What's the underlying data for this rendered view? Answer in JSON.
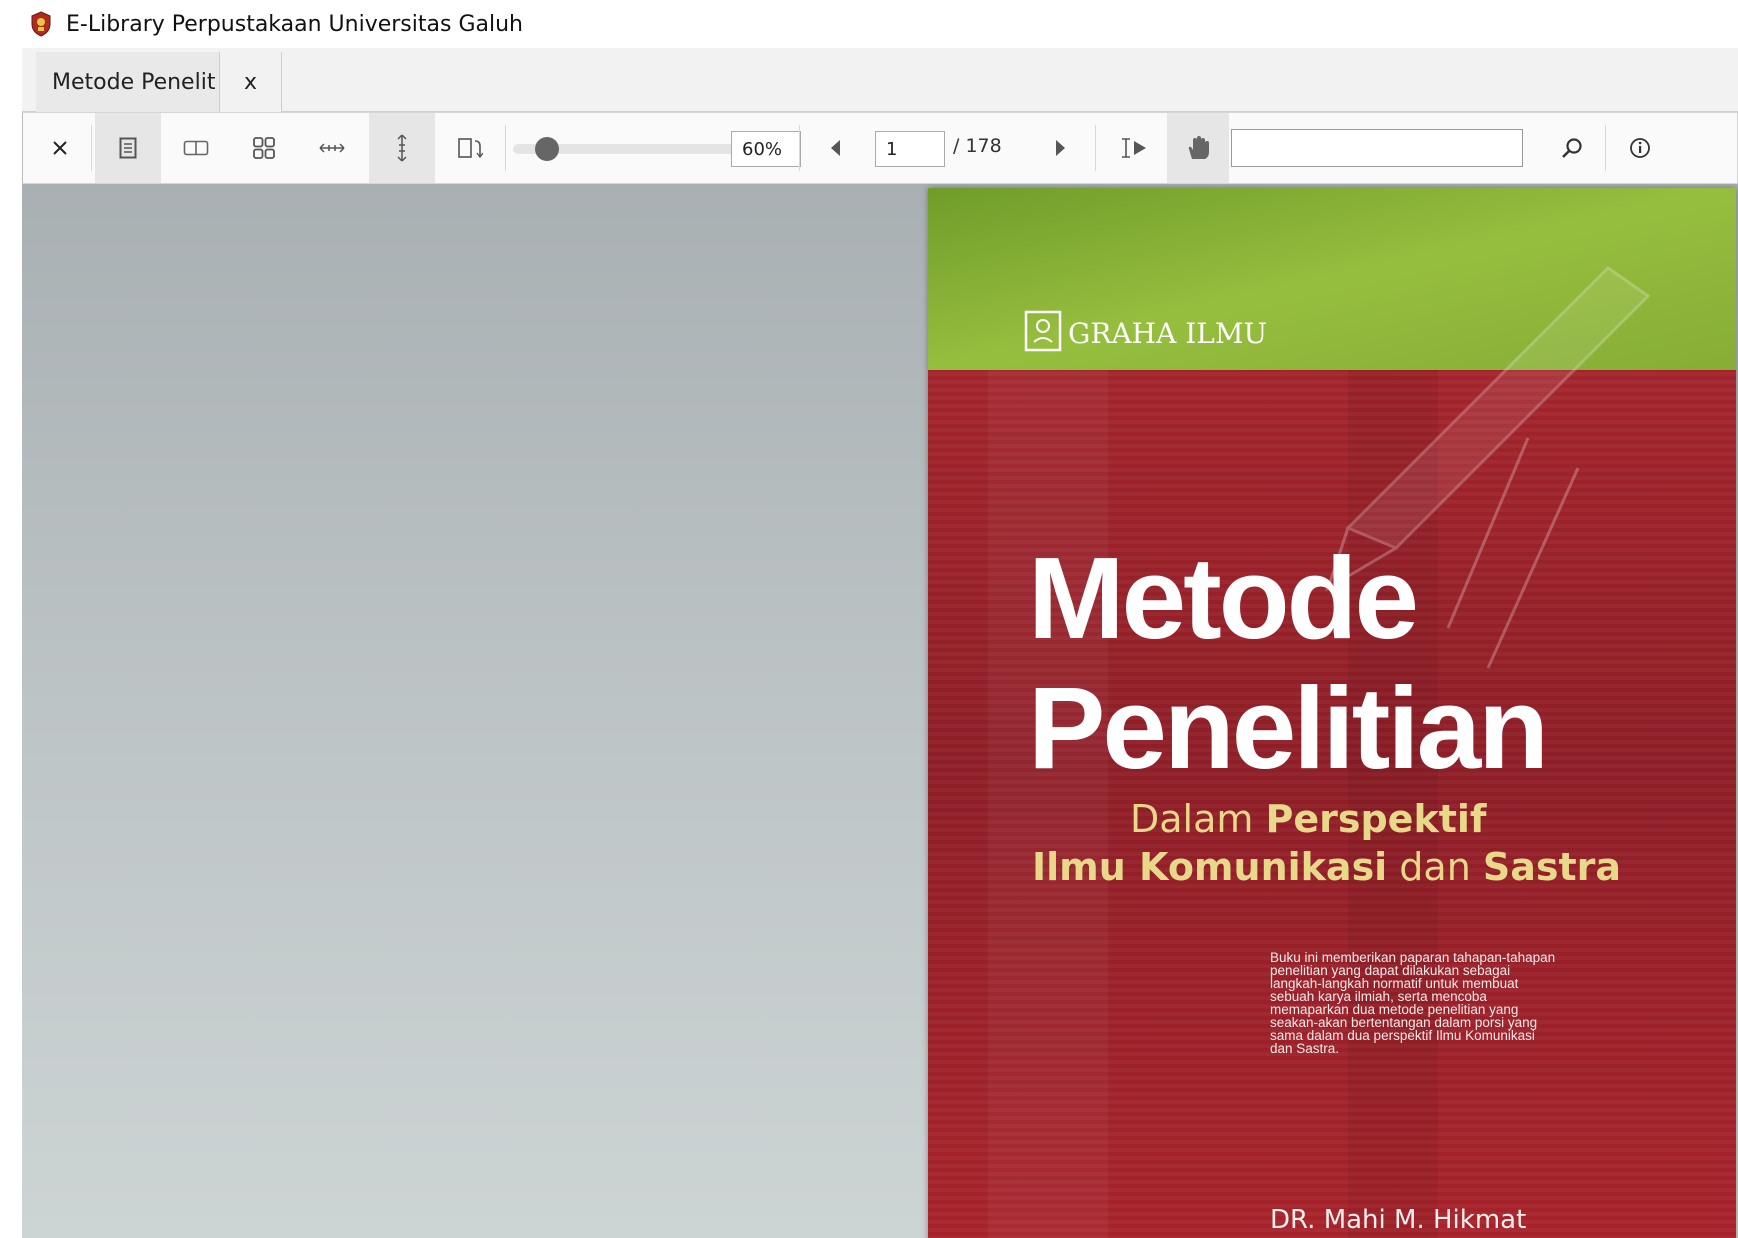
{
  "window": {
    "title": "E-Library Perpustakaan Universitas Galuh",
    "logo_icon": "university-crest-icon"
  },
  "tabs": [
    {
      "label": "Metode Penelit",
      "close_label": "x"
    }
  ],
  "toolbar": {
    "close_icon": "close-icon",
    "single_page_icon": "single-page-view-icon",
    "book_view_icon": "book-view-icon",
    "thumbnails_icon": "thumbnails-grid-icon",
    "fit_width_icon": "fit-width-icon",
    "fit_height_icon": "fit-height-icon",
    "rotate_icon": "rotate-page-icon",
    "zoom_value": "60%",
    "zoom_level": 0.0,
    "prev_icon": "previous-page-icon",
    "current_page": "1",
    "total_pages": "/ 178",
    "next_icon": "next-page-icon",
    "text_select_icon": "text-select-icon",
    "pan_icon": "hand-pan-icon",
    "search_value": "",
    "search_icon": "search-icon",
    "info_icon": "info-icon"
  },
  "document": {
    "publisher": "GRAHA ILMU",
    "title_line1": "Metode",
    "title_line2": "Penelitian",
    "subtitle_line1_a": "Dalam ",
    "subtitle_line1_b": "Perspektif",
    "subtitle_line2_a": "Ilmu Komunikasi",
    "subtitle_line2_b": " dan ",
    "subtitle_line2_c": "Sastra",
    "blurb": [
      "Buku ini memberikan paparan tahapan-tahapan",
      "penelitian yang dapat dilakukan sebagai",
      "langkah-langkah normatif untuk membuat",
      "sebuah karya ilmiah, serta mencoba",
      "memaparkan dua metode penelitian yang",
      "seakan-akan bertentangan dalam porsi yang",
      "sama dalam dua perspektif Ilmu Komunikasi",
      "dan Sastra."
    ],
    "author": "DR. Mahi M. Hikmat",
    "colors": {
      "green": "#8db33a",
      "red": "#a8232b",
      "accent_yellow": "#e8d98a"
    }
  }
}
